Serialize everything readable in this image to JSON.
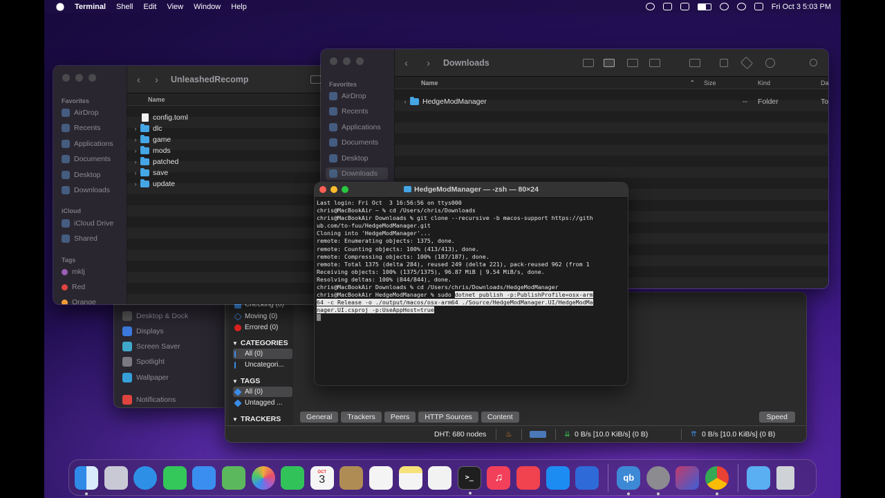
{
  "menubar": {
    "app": "Terminal",
    "items": [
      "Shell",
      "Edit",
      "View",
      "Window",
      "Help"
    ],
    "clock": "Fri Oct 3  5:03 PM"
  },
  "finder_left": {
    "title": "UnleashedRecomp",
    "sidebar": {
      "favorites_header": "Favorites",
      "favorites": [
        "AirDrop",
        "Recents",
        "Applications",
        "Documents",
        "Desktop",
        "Downloads"
      ],
      "icloud_header": "iCloud",
      "icloud": [
        "iCloud Drive",
        "Shared"
      ],
      "tags_header": "Tags",
      "tags": [
        {
          "name": "mklj",
          "color": "#9b5fb5"
        },
        {
          "name": "Red",
          "color": "#e0443e"
        },
        {
          "name": "Orange",
          "color": "#f09a37"
        }
      ]
    },
    "column_name": "Name",
    "files": [
      {
        "name": "config.toml",
        "type": "file"
      },
      {
        "name": "dlc",
        "type": "folder"
      },
      {
        "name": "game",
        "type": "folder"
      },
      {
        "name": "mods",
        "type": "folder"
      },
      {
        "name": "patched",
        "type": "folder"
      },
      {
        "name": "save",
        "type": "folder"
      },
      {
        "name": "update",
        "type": "folder"
      }
    ]
  },
  "finder_right": {
    "title": "Downloads",
    "sidebar": {
      "favorites_header": "Favorites",
      "favorites": [
        "AirDrop",
        "Recents",
        "Applications",
        "Documents",
        "Desktop",
        "Downloads"
      ]
    },
    "columns": {
      "name": "Name",
      "size": "Size",
      "kind": "Kind",
      "date": "Dat"
    },
    "rows": [
      {
        "name": "HedgeModManager",
        "size": "--",
        "kind": "Folder",
        "date": "To"
      }
    ]
  },
  "terminal": {
    "title": "HedgeModManager — -zsh — 80×24",
    "lines": [
      "Last login: Fri Oct  3 16:56:56 on ttys000",
      "chris@MacBookAir ~ % cd /Users/chris/Downloads",
      "chris@MacBookAir Downloads % git clone --recursive -b macos-support https://gith",
      "ub.com/to-fuu/HedgeModManager.git",
      "Cloning into 'HedgeModManager'...",
      "remote: Enumerating objects: 1375, done.",
      "remote: Counting objects: 100% (413/413), done.",
      "remote: Compressing objects: 100% (187/187), done.",
      "remote: Total 1375 (delta 284), reused 249 (delta 221), pack-reused 962 (from 1",
      "Receiving objects: 100% (1375/1375), 96.87 MiB | 9.54 MiB/s, done.",
      "Resolving deltas: 100% (844/844), done.",
      "chris@MacBookAir Downloads % cd /Users/chris/Downloads/HedgeModManager"
    ],
    "prompt": "chris@MacBookAir HedgeModManager % sudo ",
    "selected_lines": [
      "dotnet publish -p:PublishProfile=osx-arm",
      "64 -c Release -o ./output/macos/osx-arm64 ./Source/HedgeModManager.UI/HedgeModMa",
      "nager.UI.csproj -p:UseAppHost=true"
    ]
  },
  "torrent": {
    "status_items": [
      {
        "label": "Checking (0)",
        "color": "#3c8ce7"
      },
      {
        "label": "Moving (0)",
        "color": "#3c8ce7"
      },
      {
        "label": "Errored (0)",
        "color": "#e0241f"
      }
    ],
    "categories_header": "CATEGORIES",
    "categories": [
      "All (0)",
      "Uncategori..."
    ],
    "tags_header": "TAGS",
    "tags": [
      "All (0)",
      "Untagged ..."
    ],
    "trackers_header": "TRACKERS",
    "tabs": [
      "General",
      "Trackers",
      "Peers",
      "HTTP Sources",
      "Content"
    ],
    "speed_button": "Speed",
    "dht": "DHT: 680 nodes",
    "download": "0 B/s [10.0 KiB/s] (0 B)",
    "upload": "0 B/s [10.0 KiB/s] (0 B)"
  },
  "settings": {
    "items": [
      {
        "label": "Desktop & Dock",
        "color": "#555"
      },
      {
        "label": "Displays",
        "color": "#3d7ae0"
      },
      {
        "label": "Screen Saver",
        "color": "#3fa7c9"
      },
      {
        "label": "Spotlight",
        "color": "#7a7a80"
      },
      {
        "label": "Wallpaper",
        "color": "#35a0d8"
      },
      {
        "label": "Notifications",
        "color": "#e0443e"
      }
    ]
  },
  "dock": {
    "apps": [
      {
        "name": "finder-icon",
        "color": "#3b9cf2",
        "run": true
      },
      {
        "name": "launchpad-icon",
        "color": "#c9c9d6",
        "run": false
      },
      {
        "name": "safari-icon",
        "color": "#2e8fe6",
        "run": false
      },
      {
        "name": "messages-icon",
        "color": "#34c759",
        "run": false
      },
      {
        "name": "mail-icon",
        "color": "#3a8ef0",
        "run": false
      },
      {
        "name": "maps-icon",
        "color": "#5cb85c",
        "run": false
      },
      {
        "name": "photos-icon",
        "color": "#f2a93b",
        "run": false
      },
      {
        "name": "facetime-icon",
        "color": "#32c25a",
        "run": false
      },
      {
        "name": "calendar-icon",
        "color": "#f5f5f5",
        "run": false,
        "text": "3",
        "subtext": "OCT"
      },
      {
        "name": "contacts-icon",
        "color": "#b08c55",
        "run": false
      },
      {
        "name": "reminders-icon",
        "color": "#f4f4f4",
        "run": false
      },
      {
        "name": "notes-icon",
        "color": "#f7e27a",
        "run": false
      },
      {
        "name": "freeform-icon",
        "color": "#f2f2f2",
        "run": false
      },
      {
        "name": "terminal-icon",
        "color": "#1f1f1f",
        "run": true
      },
      {
        "name": "music-icon",
        "color": "#f2405a",
        "run": false
      },
      {
        "name": "news-icon",
        "color": "#f1424f",
        "run": false
      },
      {
        "name": "app-store-icon",
        "color": "#1c8cf3",
        "run": false
      },
      {
        "name": "roblox-icon",
        "color": "#2f6ad9",
        "run": false
      },
      {
        "name": "qbittorrent-icon",
        "color": "#3d89d6",
        "run": true,
        "text": "qb"
      },
      {
        "name": "system-settings-icon",
        "color": "#8b8b90",
        "run": true
      },
      {
        "name": "app-icon",
        "color": "#c23b6a",
        "run": false
      },
      {
        "name": "chrome-icon",
        "color": "#e6e6e6",
        "run": true
      },
      {
        "name": "downloads-folder-icon",
        "color": "#5aaef2",
        "run": false
      },
      {
        "name": "trash-icon",
        "color": "#cfd2d6",
        "run": false
      }
    ]
  }
}
